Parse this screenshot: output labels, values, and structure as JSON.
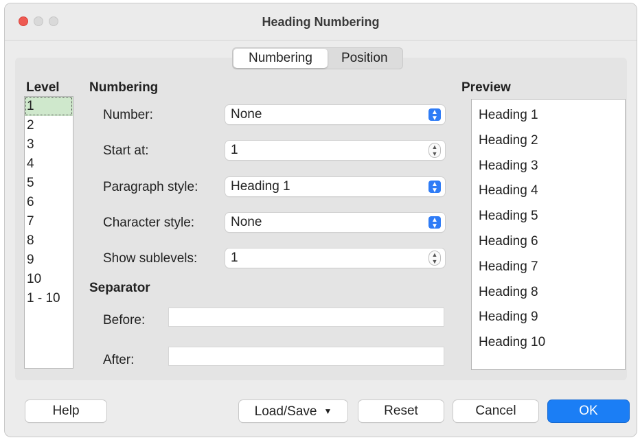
{
  "window": {
    "title": "Heading Numbering"
  },
  "tabs": [
    {
      "label": "Numbering",
      "active": true
    },
    {
      "label": "Position",
      "active": false
    }
  ],
  "level": {
    "heading": "Level",
    "items": [
      "1",
      "2",
      "3",
      "4",
      "5",
      "6",
      "7",
      "8",
      "9",
      "10",
      "1 - 10"
    ],
    "selected": "1"
  },
  "numbering": {
    "heading": "Numbering",
    "number_label": "Number:",
    "number_value": "None",
    "start_at_label": "Start at:",
    "start_at_value": "1",
    "paragraph_style_label": "Paragraph style:",
    "paragraph_style_value": "Heading 1",
    "character_style_label": "Character style:",
    "character_style_value": "None",
    "show_sublevels_label": "Show sublevels:",
    "show_sublevels_value": "1"
  },
  "separator": {
    "heading": "Separator",
    "before_label": "Before:",
    "before_value": "",
    "after_label": "After:",
    "after_value": ""
  },
  "preview": {
    "heading": "Preview",
    "items": [
      "Heading 1",
      "Heading 2",
      "Heading 3",
      "Heading 4",
      "Heading 5",
      "Heading 6",
      "Heading 7",
      "Heading 8",
      "Heading 9",
      "Heading 10"
    ]
  },
  "buttons": {
    "help": "Help",
    "load_save": "Load/Save",
    "reset": "Reset",
    "cancel": "Cancel",
    "ok": "OK"
  },
  "icons": {
    "select_arrow": "up-down-chevron-icon",
    "stepper": "stepper-icon",
    "dropdown": "triangle-down-icon"
  },
  "colors": {
    "accent": "#1b7ef5",
    "close_button": "#ee5a52",
    "selected_row": "#cfe8cc"
  }
}
